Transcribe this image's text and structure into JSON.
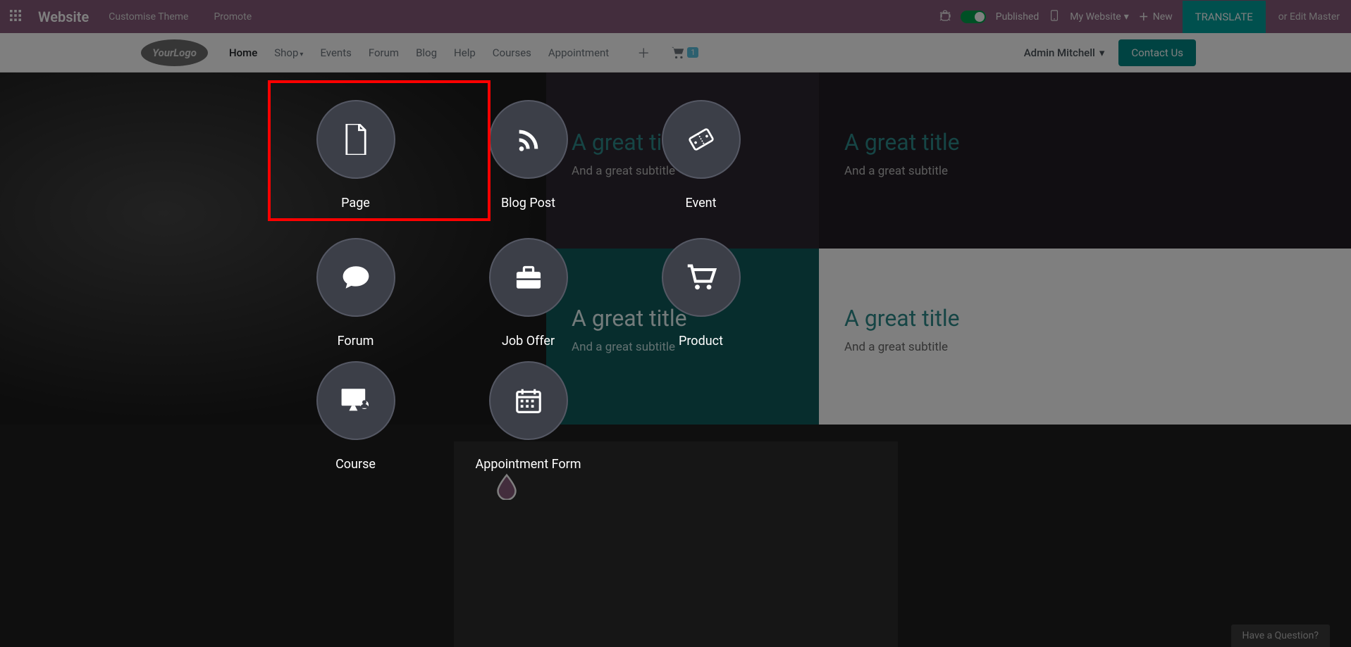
{
  "topbar": {
    "brand": "Website",
    "customise": "Customise Theme",
    "promote": "Promote",
    "published": "Published",
    "my_website": "My Website",
    "new": "New",
    "translate": "TRANSLATE",
    "or_edit": "or Edit Master"
  },
  "nav": {
    "home": "Home",
    "shop": "Shop",
    "events": "Events",
    "forum": "Forum",
    "blog": "Blog",
    "help": "Help",
    "courses": "Courses",
    "appointment": "Appointment",
    "cart_count": "1",
    "user": "Admin Mitchell",
    "contact": "Contact Us"
  },
  "hero": {
    "title": "A great title",
    "subtitle": "And a great subtitle"
  },
  "new_items": [
    {
      "label": "Page"
    },
    {
      "label": "Blog Post"
    },
    {
      "label": "Event"
    },
    {
      "label": "Forum"
    },
    {
      "label": "Job Offer"
    },
    {
      "label": "Product"
    },
    {
      "label": "Course"
    },
    {
      "label": "Appointment Form"
    }
  ],
  "have_question": "Have a Question?"
}
